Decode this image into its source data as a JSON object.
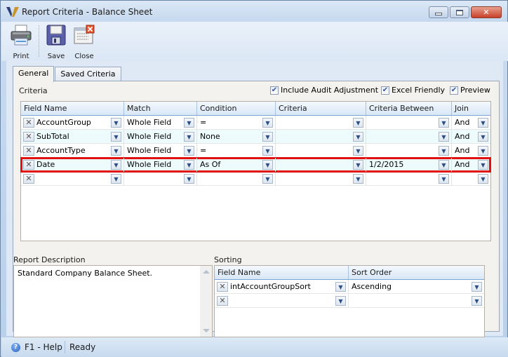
{
  "window": {
    "title": "Report Criteria - Balance Sheet",
    "controls": {
      "minimize": "minimize",
      "maximize": "maximize",
      "close": "close"
    }
  },
  "toolbar": {
    "print_label": "Print",
    "save_label": "Save",
    "close_label": "Close"
  },
  "tabs": [
    {
      "label": "General",
      "active": true
    },
    {
      "label": "Saved Criteria",
      "active": false
    }
  ],
  "criteria": {
    "label": "Criteria",
    "options": {
      "include_audit_adjustment": {
        "label": "Include Audit Adjustment",
        "checked": true
      },
      "excel_friendly": {
        "label": "Excel Friendly",
        "checked": true
      },
      "preview": {
        "label": "Preview",
        "checked": true
      }
    },
    "columns": [
      "Field Name",
      "Match",
      "Condition",
      "Criteria",
      "Criteria Between",
      "Join"
    ],
    "rows": [
      {
        "field_name": "AccountGroup",
        "match": "Whole Field",
        "condition": "=",
        "criteria": "",
        "criteria_between": "",
        "join": "And"
      },
      {
        "field_name": "SubTotal",
        "match": "Whole Field",
        "condition": "None",
        "criteria": "",
        "criteria_between": "",
        "join": "And"
      },
      {
        "field_name": "AccountType",
        "match": "Whole Field",
        "condition": "=",
        "criteria": "",
        "criteria_between": "",
        "join": "And"
      },
      {
        "field_name": "Date",
        "match": "Whole Field",
        "condition": "As Of",
        "criteria": "",
        "criteria_between": "1/2/2015",
        "join": "And",
        "highlighted": true
      },
      {
        "field_name": "",
        "match": "",
        "condition": "",
        "criteria": "",
        "criteria_between": "",
        "join": ""
      }
    ]
  },
  "report_description": {
    "label": "Report Description",
    "value": "Standard Company Balance Sheet."
  },
  "sorting": {
    "label": "Sorting",
    "columns": [
      "Field Name",
      "Sort Order"
    ],
    "rows": [
      {
        "field_name": "intAccountGroupSort",
        "sort_order": "Ascending"
      },
      {
        "field_name": "",
        "sort_order": ""
      }
    ]
  },
  "statusbar": {
    "help": "F1 - Help",
    "status": "Ready"
  },
  "colors": {
    "highlight_border": "#e01010",
    "header_border": "#7ba3d3",
    "alt_row": "#eefbfd"
  }
}
